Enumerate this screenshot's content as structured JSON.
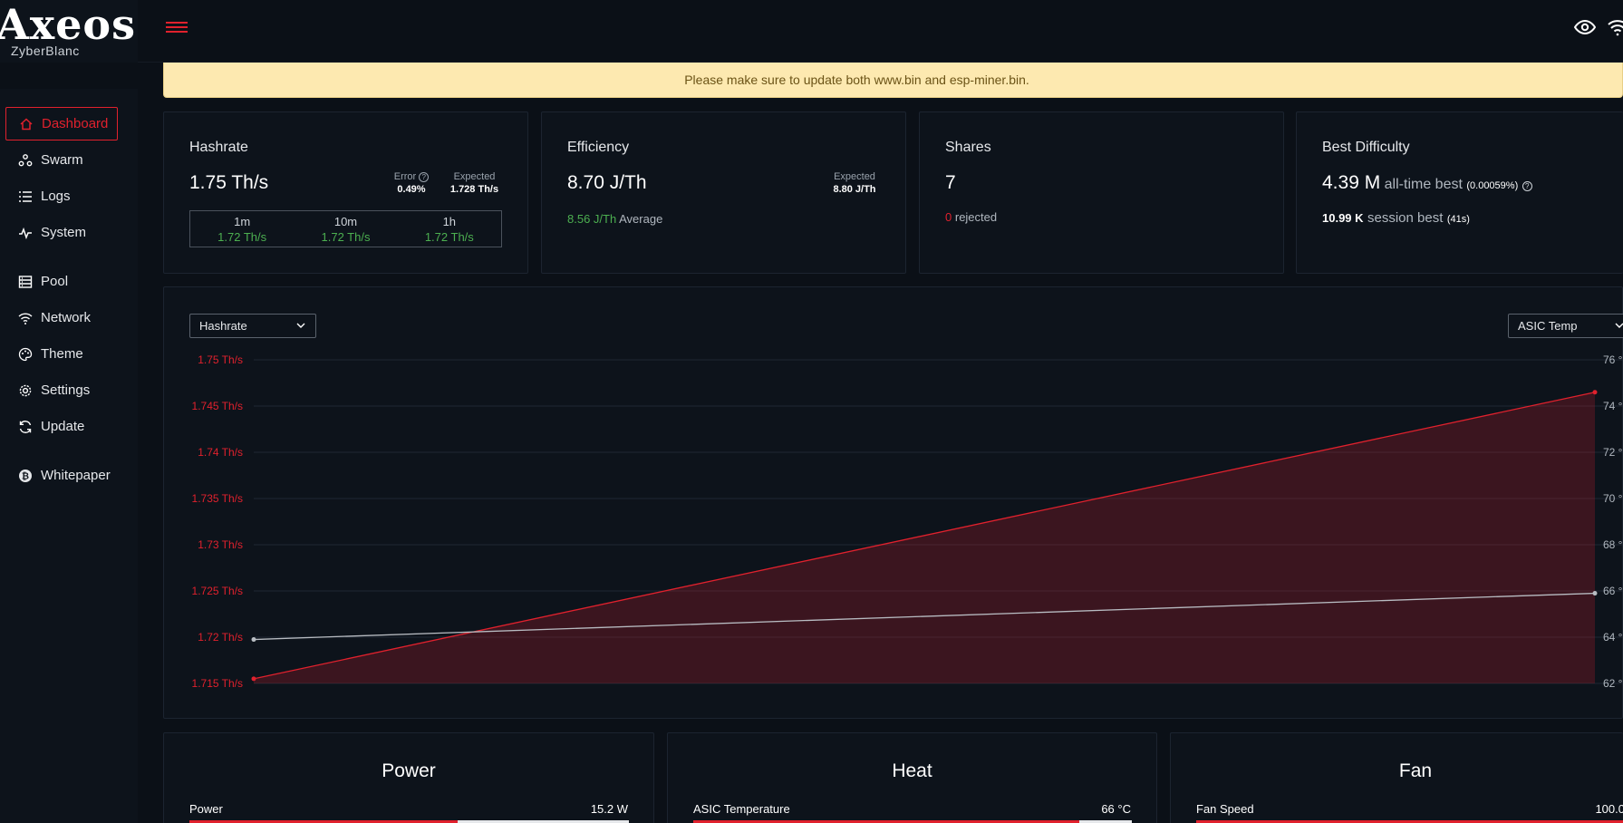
{
  "app": {
    "logo": "Axeos",
    "subtitle": "ZyberBlanc"
  },
  "banner": {
    "text": "Please make sure to update both www.bin and esp-miner.bin."
  },
  "sidebar": {
    "items": [
      {
        "label": "Dashboard",
        "icon": "home-icon",
        "active": true
      },
      {
        "label": "Swarm",
        "icon": "swarm-icon"
      },
      {
        "label": "Logs",
        "icon": "list-icon"
      },
      {
        "label": "System",
        "icon": "pulse-icon"
      },
      {
        "label": "Pool",
        "icon": "server-icon"
      },
      {
        "label": "Network",
        "icon": "wifi-icon"
      },
      {
        "label": "Theme",
        "icon": "palette-icon"
      },
      {
        "label": "Settings",
        "icon": "gear-icon"
      },
      {
        "label": "Update",
        "icon": "refresh-icon"
      },
      {
        "label": "Whitepaper",
        "icon": "bitcoin-icon"
      }
    ]
  },
  "cards": {
    "hashrate": {
      "title": "Hashrate",
      "value": "1.75 Th/s",
      "error_label": "Error",
      "error_value": "0.49%",
      "expected_label": "Expected",
      "expected_value": "1.728 Th/s",
      "periods": [
        {
          "label": "1m",
          "value": "1.72 Th/s"
        },
        {
          "label": "10m",
          "value": "1.72 Th/s"
        },
        {
          "label": "1h",
          "value": "1.72 Th/s"
        }
      ]
    },
    "efficiency": {
      "title": "Efficiency",
      "value": "8.70 J/Th",
      "expected_label": "Expected",
      "expected_value": "8.80 J/Th",
      "average_value": "8.56 J/Th",
      "average_label": "Average"
    },
    "shares": {
      "title": "Shares",
      "value": "7",
      "rejected_count": "0",
      "rejected_label": "rejected"
    },
    "best_difficulty": {
      "title": "Best Difficulty",
      "value": "4.39 M",
      "value_label": "all-time best",
      "value_pct": "(0.00059%)",
      "session_value": "10.99 K",
      "session_label": "session best",
      "session_time": "(41s)"
    }
  },
  "chart": {
    "left_select": "Hashrate",
    "right_select": "ASIC Temp"
  },
  "chart_data": {
    "type": "line",
    "x": [
      0,
      1
    ],
    "series": [
      {
        "name": "Hashrate",
        "axis": "left",
        "values": [
          1.7155,
          1.7465
        ],
        "color": "#e0212d",
        "fill": true
      },
      {
        "name": "ASIC Temp",
        "axis": "right",
        "values": [
          63.9,
          65.9
        ],
        "color": "#b8bcc2",
        "fill": false
      }
    ],
    "y_left": {
      "ticks": [
        "1.75 Th/s",
        "1.745 Th/s",
        "1.74 Th/s",
        "1.735 Th/s",
        "1.73 Th/s",
        "1.725 Th/s",
        "1.72 Th/s",
        "1.715 Th/s"
      ],
      "ylim": [
        1.715,
        1.75
      ]
    },
    "y_right": {
      "ticks": [
        "76 °",
        "74 °",
        "72 °",
        "70 °",
        "68 °",
        "66 °",
        "64 °",
        "62 °"
      ],
      "ylim": [
        62,
        76
      ]
    },
    "grid": true
  },
  "gauges": [
    {
      "title": "Power",
      "label": "Power",
      "value": "15.2 W",
      "fraction": 0.61
    },
    {
      "title": "Heat",
      "label": "ASIC Temperature",
      "value": "66 °C",
      "fraction": 0.88
    },
    {
      "title": "Fan",
      "label": "Fan Speed",
      "value": "100.0",
      "fraction": 1.0
    }
  ],
  "colors": {
    "accent": "#e0212d",
    "good": "#4caf50",
    "banner_bg": "#fde9b0"
  }
}
